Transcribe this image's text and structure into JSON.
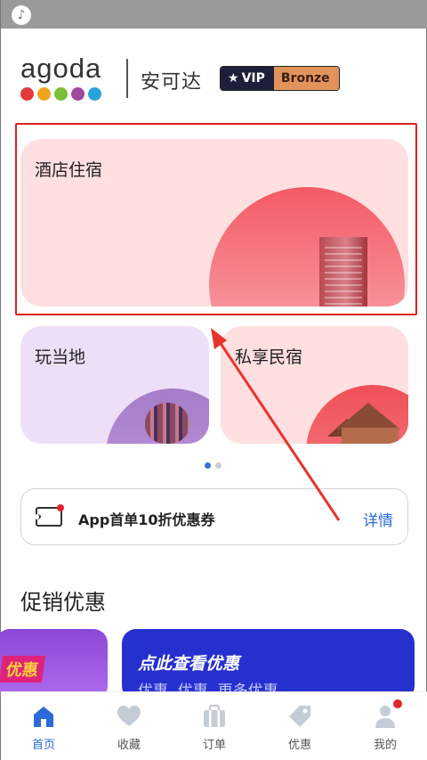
{
  "status": {
    "icon": "music-note-icon"
  },
  "header": {
    "logo": "agoda",
    "logo_dots": [
      "#e23b3b",
      "#f0a41d",
      "#7bbf3a",
      "#a0479e",
      "#2aa3dd"
    ],
    "brand_cn": "安可达",
    "vip_label": "VIP",
    "tier_label": "Bronze"
  },
  "cards": {
    "hotel": "酒店住宿",
    "local": "玩当地",
    "home": "私享民宿"
  },
  "pager": {
    "count": 2,
    "active": 0
  },
  "coupon": {
    "text": "App首单10折优惠券",
    "detail": "详情"
  },
  "promo": {
    "title": "促销优惠",
    "left_label": "优惠",
    "right_title": "点此查看优惠",
    "right_sub": "优惠, 优惠, 更多优惠"
  },
  "tabs": [
    {
      "label": "首页",
      "icon": "home-icon",
      "active": true
    },
    {
      "label": "收藏",
      "icon": "heart-icon",
      "active": false
    },
    {
      "label": "订单",
      "icon": "briefcase-icon",
      "active": false
    },
    {
      "label": "优惠",
      "icon": "tag-icon",
      "active": false
    },
    {
      "label": "我的",
      "icon": "user-icon",
      "active": false,
      "badge": true
    }
  ],
  "colors": {
    "accent": "#2b6ad8",
    "highlight": "#e01e1e",
    "vip_dark": "#1d1f3a",
    "bronze": "#e2935c"
  }
}
